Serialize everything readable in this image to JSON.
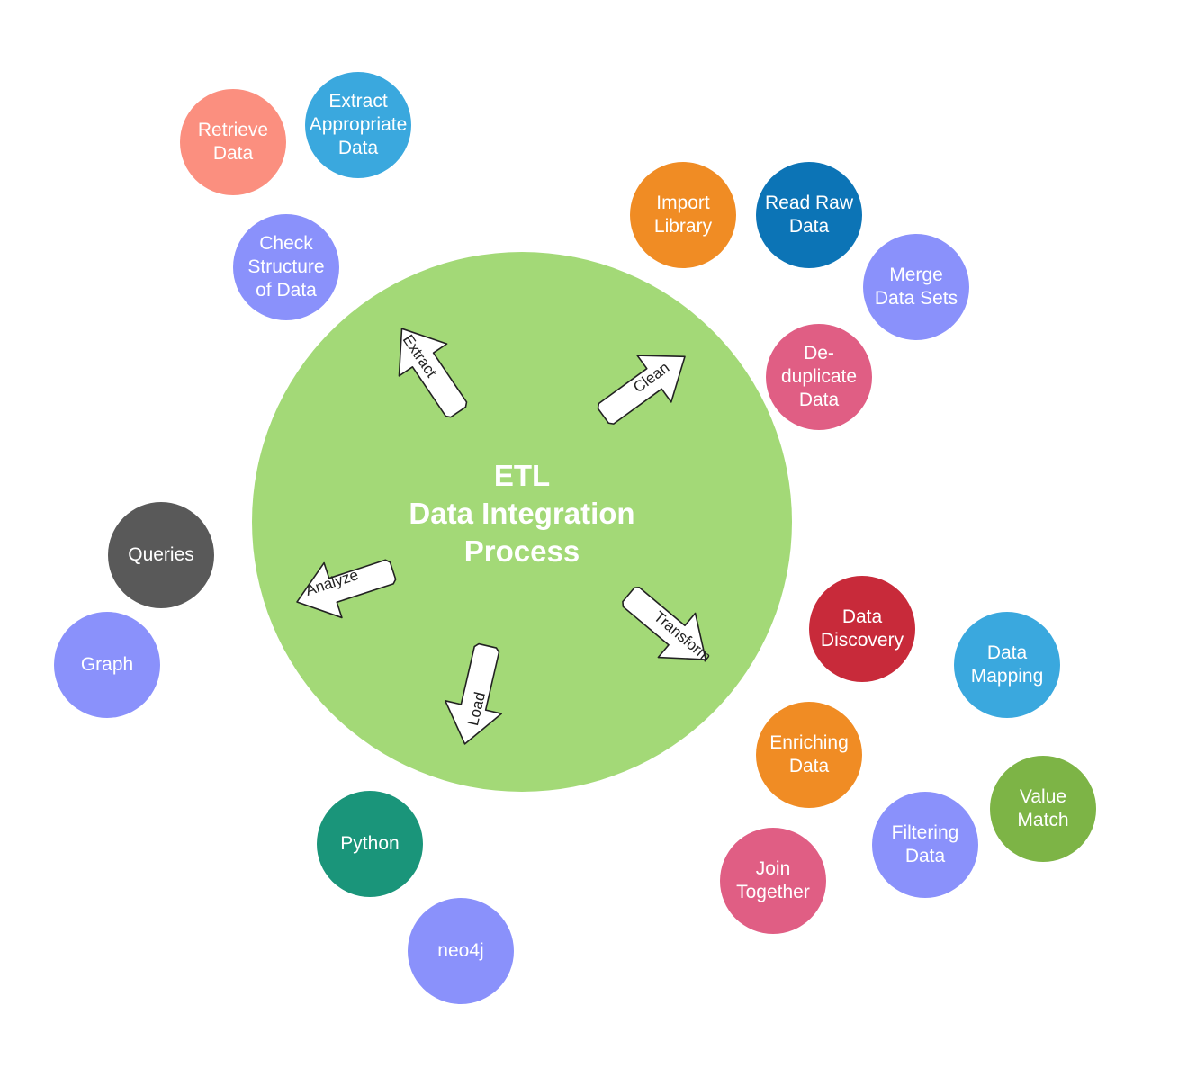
{
  "hub": {
    "lines": [
      "ETL",
      "Data Integration",
      "Process"
    ],
    "color": "#a3d977"
  },
  "arrows": {
    "extract": "Extract",
    "clean": "Clean",
    "analyze": "Analyze",
    "load": "Load",
    "transform": "Transform"
  },
  "nodes": {
    "retrieve_data": {
      "lines": [
        "Retrieve",
        "Data"
      ],
      "color": "#fb8f7f"
    },
    "extract_appropriate_data": {
      "lines": [
        "Extract",
        "Appropriate",
        "Data"
      ],
      "color": "#3aa8de"
    },
    "check_structure": {
      "lines": [
        "Check",
        "Structure",
        "of Data"
      ],
      "color": "#8a91fb"
    },
    "import_library": {
      "lines": [
        "Import",
        "Library"
      ],
      "color": "#f08c24"
    },
    "read_raw_data": {
      "lines": [
        "Read Raw",
        "Data"
      ],
      "color": "#0c74b6"
    },
    "merge_data_sets": {
      "lines": [
        "Merge",
        "Data Sets"
      ],
      "color": "#8a91fb"
    },
    "deduplicate_data": {
      "lines": [
        "De-",
        "duplicate",
        "Data"
      ],
      "color": "#e05e84"
    },
    "queries": {
      "lines": [
        "Queries"
      ],
      "color": "#595959"
    },
    "graph": {
      "lines": [
        "Graph"
      ],
      "color": "#8a91fb"
    },
    "data_discovery": {
      "lines": [
        "Data",
        "Discovery"
      ],
      "color": "#c82a3a"
    },
    "data_mapping": {
      "lines": [
        "Data",
        "Mapping"
      ],
      "color": "#3aa8de"
    },
    "enriching_data": {
      "lines": [
        "Enriching",
        "Data"
      ],
      "color": "#f08c24"
    },
    "value_match": {
      "lines": [
        "Value",
        "Match"
      ],
      "color": "#7db446"
    },
    "filtering_data": {
      "lines": [
        "Filtering",
        "Data"
      ],
      "color": "#8a91fb"
    },
    "join_together": {
      "lines": [
        "Join",
        "Together"
      ],
      "color": "#e05e84"
    },
    "python": {
      "lines": [
        "Python"
      ],
      "color": "#1a957a"
    },
    "neo4j": {
      "lines": [
        "neo4j"
      ],
      "color": "#8a91fb"
    }
  }
}
